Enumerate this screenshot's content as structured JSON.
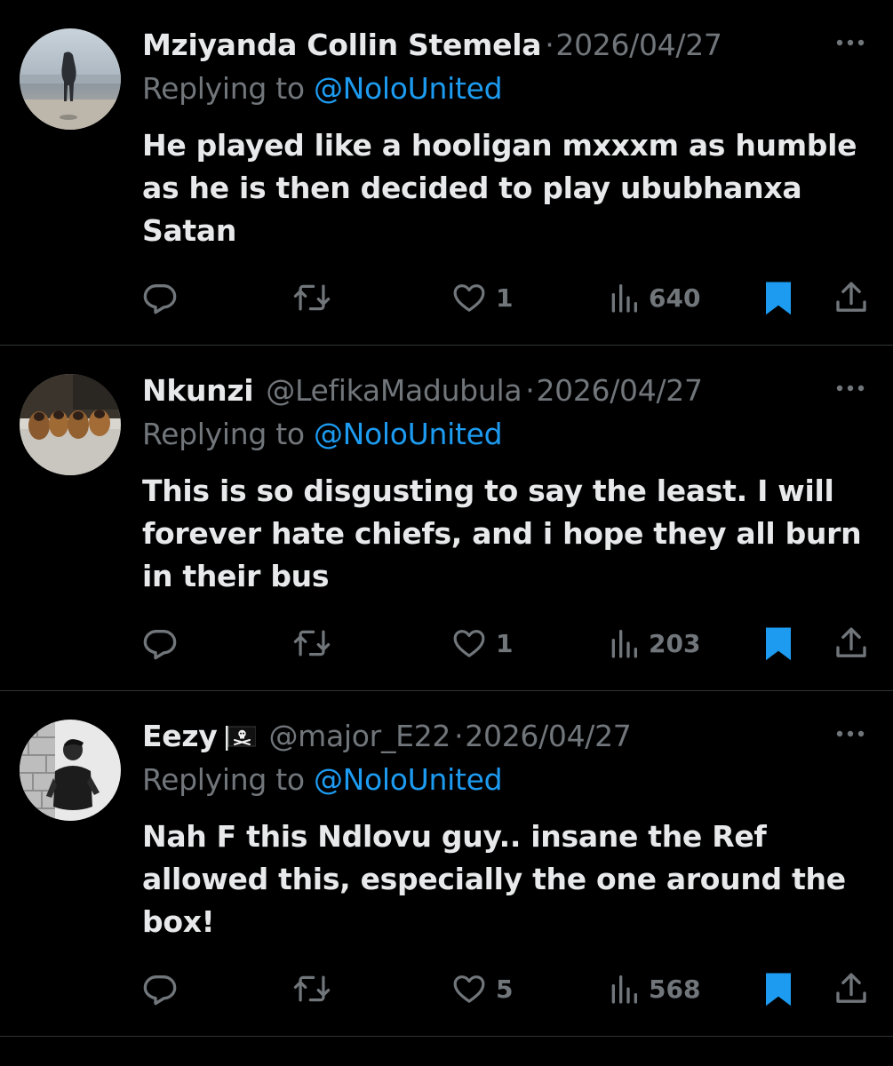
{
  "colors": {
    "background": "#000000",
    "primary_text": "#e7e9ea",
    "secondary_text": "#71767b",
    "accent": "#1d9bf0",
    "divider": "#2f3336"
  },
  "icons": {
    "reply": "reply-icon",
    "repost": "repost-icon",
    "like": "heart-icon",
    "views": "views-icon",
    "bookmark": "bookmark-icon",
    "share": "share-icon",
    "more": "more-icon"
  },
  "tweets": [
    {
      "display_name": "Mziyanda Collin Stemela",
      "handle": "",
      "separator": "·",
      "date": "2026/04/27",
      "reply_prefix": "Replying to",
      "reply_to": "@NoloUnited",
      "lines": [
        "He played like a hooligan mxxxm as humble",
        "as he is then decided to play ububhanxa",
        "Satan"
      ],
      "likes": "1",
      "views": "640",
      "bookmarked": true
    },
    {
      "display_name": "Nkunzi",
      "handle": "@LefikaMadubula",
      "separator": "·",
      "date": "2026/04/27",
      "reply_prefix": "Replying to",
      "reply_to": "@NoloUnited",
      "lines": [
        "This is so disgusting to say the least. I will",
        "forever hate chiefs, and i hope they all burn",
        "in their bus"
      ],
      "likes": "1",
      "views": "203",
      "bookmarked": true
    },
    {
      "display_name": "Eezy",
      "emoji": "pirate-flag-icon",
      "handle": "@major_E22",
      "separator": "·",
      "date": "2026/04/27",
      "reply_prefix": "Replying to",
      "reply_to": "@NoloUnited",
      "lines": [
        "Nah F this Ndlovu guy.. insane the Ref",
        "allowed this, especially the one around the",
        "box!"
      ],
      "likes": "5",
      "views": "568",
      "bookmarked": true
    }
  ]
}
